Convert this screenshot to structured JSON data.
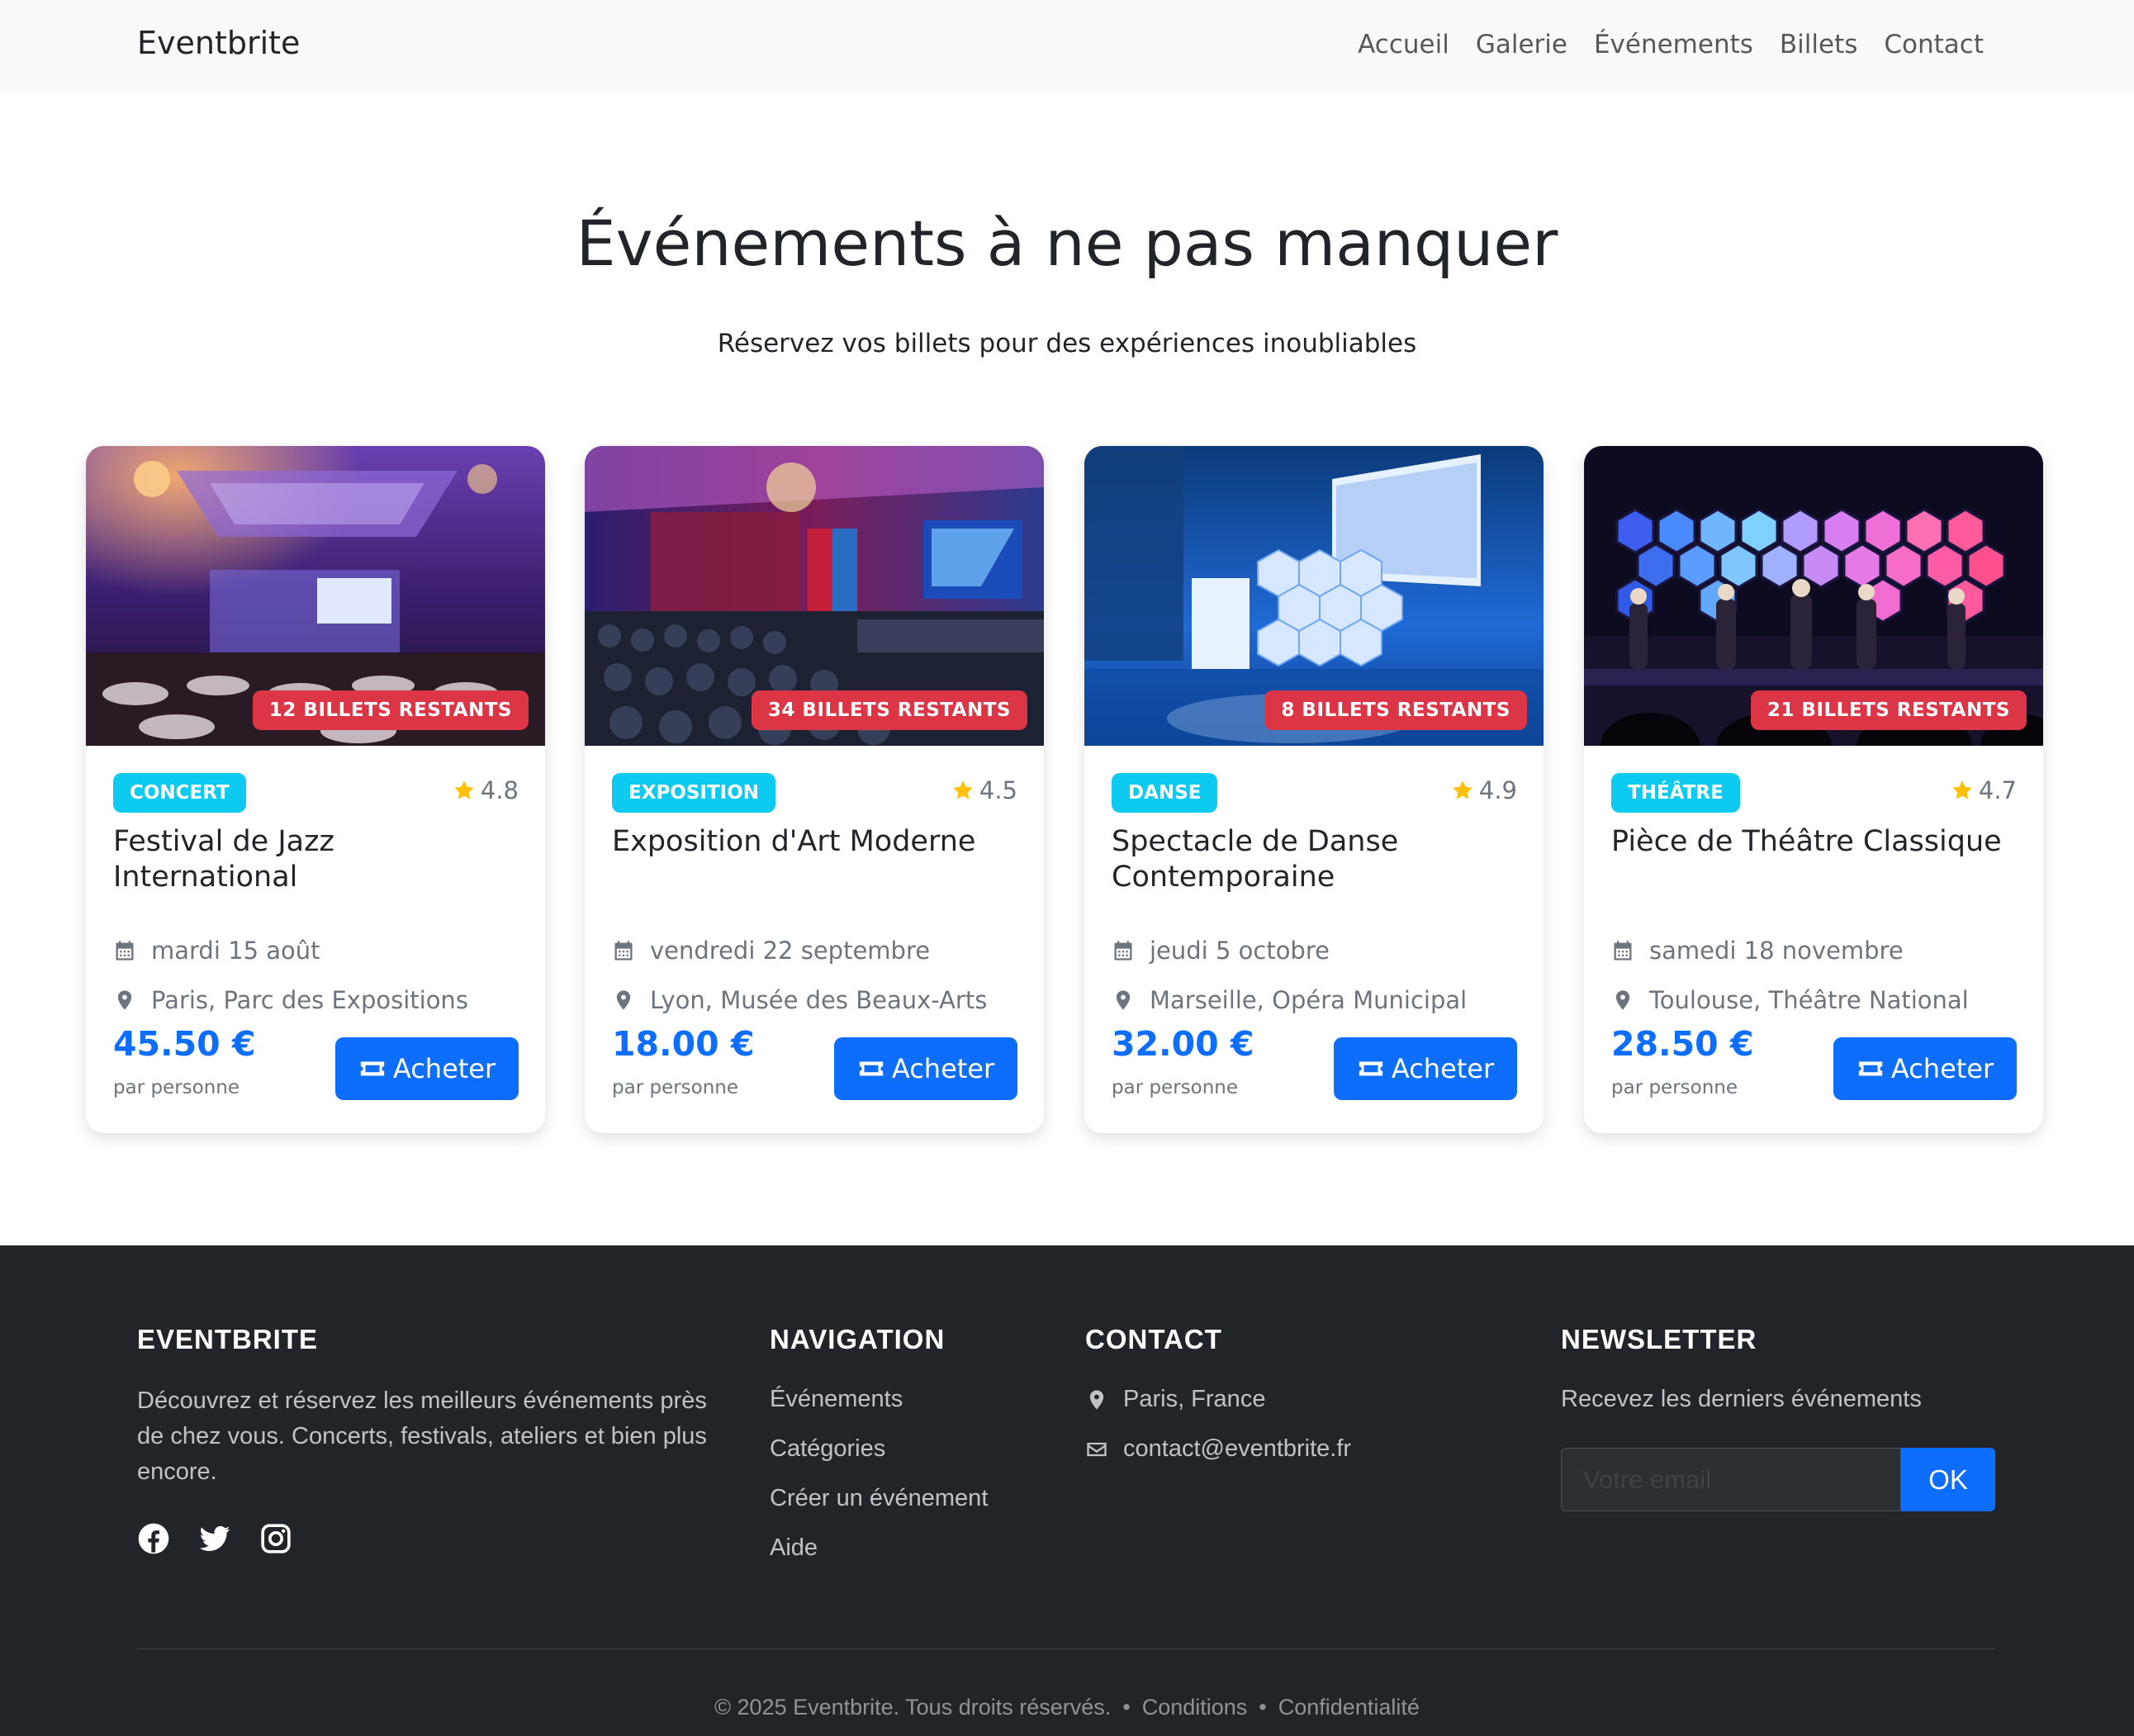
{
  "navbar": {
    "brand": "Eventbrite",
    "links": [
      "Accueil",
      "Galerie",
      "Événements",
      "Billets",
      "Contact"
    ]
  },
  "hero": {
    "title": "Événements à ne pas manquer",
    "subtitle": "Réservez vos billets pour des expériences inoubliables"
  },
  "cards": [
    {
      "stock": "12 BILLETS RESTANTS",
      "category": "CONCERT",
      "rating": "4.8",
      "title": "Festival de Jazz International",
      "date": "mardi 15 août",
      "location": "Paris, Parc des Expositions",
      "price": "45.50 €",
      "per": "par personne",
      "button": "Acheter"
    },
    {
      "stock": "34 BILLETS RESTANTS",
      "category": "EXPOSITION",
      "rating": "4.5",
      "title": "Exposition d'Art Moderne",
      "date": "vendredi 22 septembre",
      "location": "Lyon, Musée des Beaux-Arts",
      "price": "18.00 €",
      "per": "par personne",
      "button": "Acheter"
    },
    {
      "stock": "8 BILLETS RESTANTS",
      "category": "DANSE",
      "rating": "4.9",
      "title": "Spectacle de Danse Contemporaine",
      "date": "jeudi 5 octobre",
      "location": "Marseille, Opéra Municipal",
      "price": "32.00 €",
      "per": "par personne",
      "button": "Acheter"
    },
    {
      "stock": "21 BILLETS RESTANTS",
      "category": "THÉÂTRE",
      "rating": "4.7",
      "title": "Pièce de Théâtre Classique",
      "date": "samedi 18 novembre",
      "location": "Toulouse, Théâtre National",
      "price": "28.50 €",
      "per": "par personne",
      "button": "Acheter"
    }
  ],
  "footer": {
    "about": {
      "heading": "EVENTBRITE",
      "text": "Découvrez et réservez les meilleurs événements près de chez vous. Concerts, festivals, ateliers et bien plus encore.",
      "social_icons": [
        "facebook-icon",
        "twitter-icon",
        "instagram-icon"
      ]
    },
    "navigation": {
      "heading": "NAVIGATION",
      "links": [
        "Événements",
        "Catégories",
        "Créer un événement",
        "Aide"
      ]
    },
    "contact": {
      "heading": "CONTACT",
      "address": "Paris, France",
      "email": "contact@eventbrite.fr"
    },
    "newsletter": {
      "heading": "NEWSLETTER",
      "text": "Recevez les derniers événements",
      "placeholder": "Votre email",
      "button": "OK"
    },
    "bottom": {
      "copyright": "© 2025 Eventbrite. Tous droits réservés.",
      "separator": "•",
      "terms": "Conditions",
      "privacy": "Confidentialité"
    }
  },
  "colors": {
    "primary": "#0d6efd",
    "danger": "#dc3545",
    "info": "#0dcaf0",
    "star": "#ffc107",
    "footer_bg": "#212529"
  }
}
